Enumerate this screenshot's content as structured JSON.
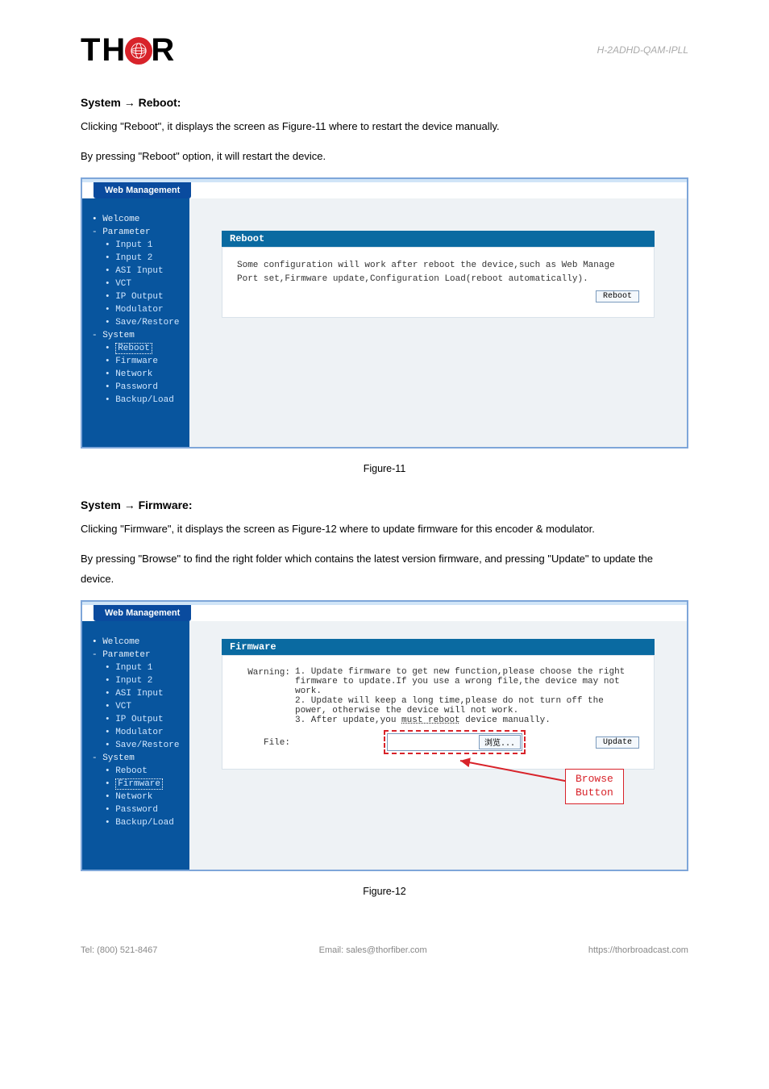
{
  "doc": {
    "header_right": "H-2ADHD-QAM-IPLL",
    "logo_left": "TH",
    "logo_right": "R",
    "footer_left": "Tel: (800) 521-8467",
    "footer_center": "Email: sales@thorfiber.com",
    "footer_right": "https://thorbroadcast.com"
  },
  "section_reboot": {
    "title": "System → Reboot:",
    "p1_a": "Clicking \"",
    "p1_b": "Reboot",
    "p1_c": "\", it displays the screen as Figure-11 where to restart the device manually.",
    "p2_a": "By pressing \"",
    "p2_b": "Reboot",
    "p2_c": "\" option, it will restart the device."
  },
  "section_firmware": {
    "title": "System → Firmware:",
    "p1_a": "Clicking \"",
    "p1_b": "Firmware",
    "p1_c": "\", it displays the screen as Figure-12 where to update firmware for this encoder & modulator.",
    "p2_a": "By pressing \"",
    "p2_b": "Browse",
    "p2_c": "\" to find the right folder which contains the latest version firmware, and pressing \"",
    "p2_d": "Update",
    "p2_e": "\" to update the device."
  },
  "web": {
    "header": "Web Management",
    "sidebar": {
      "welcome": "Welcome",
      "parameter": "Parameter",
      "input1": "Input 1",
      "input2": "Input 2",
      "asi": "ASI Input",
      "vct": "VCT",
      "ipout": "IP Output",
      "mod": "Modulator",
      "save": "Save/Restore",
      "system": "System",
      "reboot": "Reboot",
      "firmware": "Firmware",
      "network": "Network",
      "password": "Password",
      "backup": "Backup/Load"
    }
  },
  "reboot_panel": {
    "title": "Reboot",
    "text": "Some configuration will work after reboot the device,such as Web Manage Port set,Firmware update,Configuration Load(reboot automatically).",
    "button": "Reboot"
  },
  "fig11_caption": "Figure-11",
  "fw_panel": {
    "title": "Firmware",
    "warning_label": "Warning:",
    "l1": "1. Update firmware to get new function,please choose the right firmware to update.If you use a wrong file,the device may not work.",
    "l2": "2. Update will keep a long time,please do not turn off the power, otherwise the device will not work.",
    "l3_a": "3. After update,you ",
    "l3_b": "must reboot",
    "l3_c": " device manually.",
    "file_label": "File:",
    "browse": "浏览...",
    "update": "Update"
  },
  "callout": {
    "line1": "Browse",
    "line2": "Button"
  },
  "fig12_caption": "Figure-12"
}
